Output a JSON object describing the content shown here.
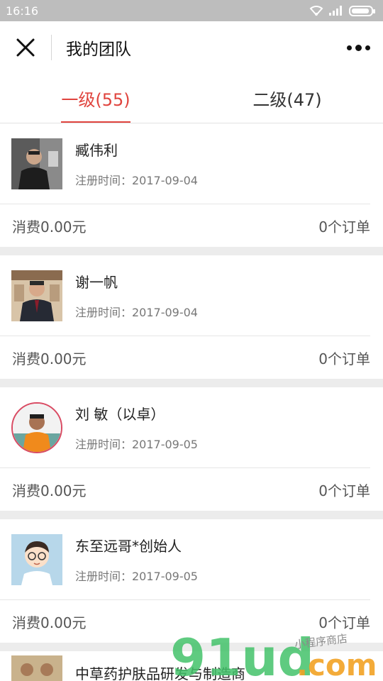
{
  "status_bar": {
    "time": "16:16"
  },
  "nav": {
    "title": "我的团队"
  },
  "tabs": [
    {
      "label": "一级(55)",
      "active": true
    },
    {
      "label": "二级(47)",
      "active": false
    }
  ],
  "members": [
    {
      "name": "臧伟利",
      "reg_date": "注册时间：2017-09-04",
      "spend": "消费0.00元",
      "orders": "0个订单"
    },
    {
      "name": "谢一帆",
      "reg_date": "注册时间：2017-09-04",
      "spend": "消费0.00元",
      "orders": "0个订单"
    },
    {
      "name": "刘 敏（以卓）",
      "reg_date": "注册时间：2017-09-05",
      "spend": "消费0.00元",
      "orders": "0个订单"
    },
    {
      "name": "东至远哥*创始人",
      "reg_date": "注册时间：2017-09-05",
      "spend": "消费0.00元",
      "orders": "0个订单"
    },
    {
      "name": "中草药护肤品研发与制造商"
    }
  ],
  "watermark": {
    "main": "91ud",
    "suffix": ".com",
    "tagline": "小程序商店"
  },
  "colors": {
    "accent": "#e0443e",
    "watermark_green": "#43c26a",
    "watermark_orange": "#f2a223"
  }
}
